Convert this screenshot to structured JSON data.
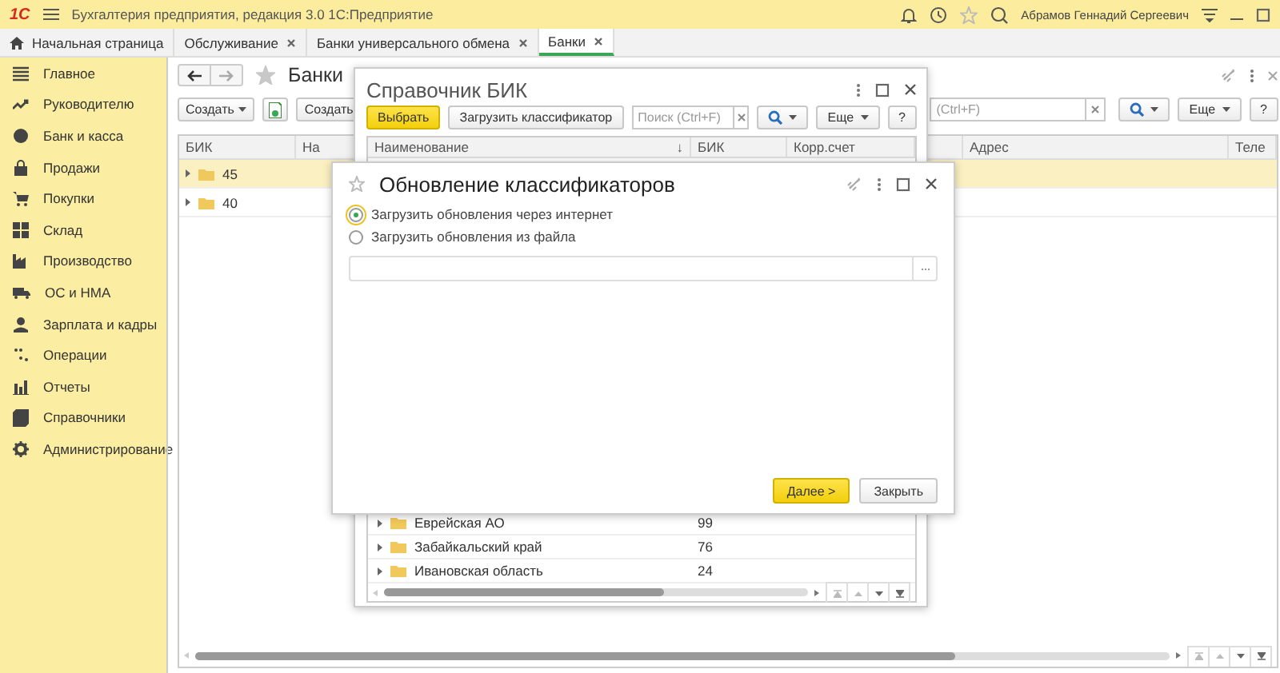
{
  "app": {
    "logo": "1С",
    "title": "Бухгалтерия предприятия, редакция 3.0 1С:Предприятие",
    "user": "Абрамов Геннадий Сергеевич"
  },
  "tabs": [
    {
      "label": "Начальная страница",
      "selected": false,
      "kind": "home"
    },
    {
      "label": "Обслуживание",
      "selected": false,
      "kind": "closable"
    },
    {
      "label": "Банки универсального обмена",
      "selected": false,
      "kind": "closable"
    },
    {
      "label": "Банки",
      "selected": true,
      "kind": "closable"
    }
  ],
  "sidebar": {
    "items": [
      {
        "label": "Главное"
      },
      {
        "label": "Руководителю"
      },
      {
        "label": "Банк и касса"
      },
      {
        "label": "Продажи"
      },
      {
        "label": "Покупки"
      },
      {
        "label": "Склад"
      },
      {
        "label": "Производство"
      },
      {
        "label": "ОС и НМА"
      },
      {
        "label": "Зарплата и кадры"
      },
      {
        "label": "Операции"
      },
      {
        "label": "Отчеты"
      },
      {
        "label": "Справочники"
      },
      {
        "label": "Администрирование"
      }
    ]
  },
  "banks_form": {
    "title": "Банки",
    "toolbar": {
      "create_button": "Создать",
      "create_button_2": "Создать",
      "search": {
        "placeholder": "(Ctrl+F)"
      },
      "more_button": "Еще",
      "help_button": "?"
    },
    "table": {
      "columns": [
        "БИК",
        "На",
        "Адрес",
        "Теле"
      ],
      "rows": [
        {
          "code": "45",
          "selected": true
        },
        {
          "code": "40",
          "selected": false
        }
      ]
    }
  },
  "bik_window": {
    "title": "Справочник БИК",
    "toolbar": {
      "select_button": "Выбрать",
      "load_button": "Загрузить классификатор",
      "search": {
        "placeholder": "Поиск (Ctrl+F)"
      },
      "more_button": "Еще",
      "help_button": "?"
    },
    "table": {
      "columns": [
        {
          "label": "Наименование",
          "sort": "↓"
        },
        {
          "label": "БИК"
        },
        {
          "label": "Корр.счет"
        }
      ],
      "rows": [
        {
          "name": "Еврейская АО",
          "bik": "99"
        },
        {
          "name": "Забайкальский край",
          "bik": "76"
        },
        {
          "name": "Ивановская область",
          "bik": "24"
        }
      ]
    }
  },
  "update_dialog": {
    "title": "Обновление классификаторов",
    "options": [
      {
        "label": "Загрузить обновления через интернет",
        "selected": true
      },
      {
        "label": "Загрузить обновления из файла",
        "selected": false
      }
    ],
    "buttons": [
      {
        "label": "Далее >",
        "kind": "primary"
      },
      {
        "label": "Закрыть",
        "kind": "default"
      }
    ]
  }
}
